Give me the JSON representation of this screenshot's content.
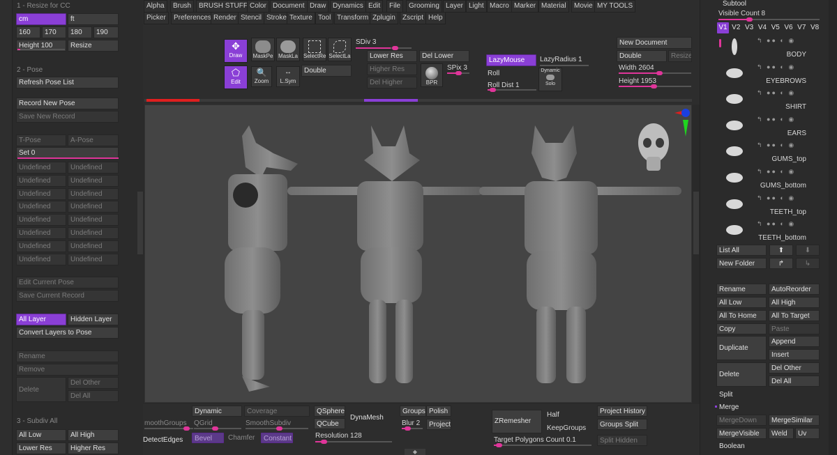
{
  "left_panel": {
    "resize_header": "1 - Resize for CC",
    "unit_cm": "cm",
    "unit_ft": "ft",
    "heights": [
      "160",
      "170",
      "180",
      "190"
    ],
    "height_label": "Height",
    "height_value": "100",
    "resize_button": "Resize",
    "pose_header": "2 - Pose",
    "refresh_pose": "Refresh Pose List",
    "record_new_pose": "Record New Pose",
    "save_new_record": "Save New Record",
    "t_pose": "T-Pose",
    "a_pose": "A-Pose",
    "set_label": "Set",
    "set_value": "0",
    "undefined_label": "Undefined",
    "edit_current_pose": "Edit Current Pose",
    "save_current_record": "Save Current Record",
    "all_layer": "All Layer",
    "hidden_layer": "Hidden Layer",
    "convert_layers": "Convert Layers to Pose",
    "rename": "Rename",
    "remove": "Remove",
    "delete": "Delete",
    "del_other": "Del Other",
    "del_all": "Del All",
    "subdiv_header": "3 - Subdiv All",
    "all_low": "All Low",
    "all_high": "All High",
    "lower_res": "Lower Res",
    "higher_res": "Higher Res"
  },
  "menubar": {
    "row1": [
      "Alpha",
      "Brush",
      "BRUSH STUFF",
      "Color",
      "Document",
      "Draw",
      "Dynamics",
      "Edit",
      "File",
      "Grooming",
      "Layer",
      "Light",
      "Macro",
      "Marker",
      "Material",
      "Movie",
      "MY TOOLS"
    ],
    "row2": [
      "Picker",
      "Preferences",
      "Render",
      "Stencil",
      "Stroke",
      "Texture",
      "Tool",
      "Transform",
      "Zplugin",
      "Zscript",
      "Help"
    ]
  },
  "toolbar": {
    "draw": "Draw",
    "edit": "Edit",
    "mask_pen": "MaskPe",
    "mask_lasso": "MaskLa",
    "zoom": "Zoom",
    "select_rect": "SelectRe",
    "select_lasso": "SelectLa",
    "lsym": "L.Sym",
    "sdiv_label": "SDiv",
    "sdiv_value": "3",
    "lower_res": "Lower Res",
    "del_lower": "Del Lower",
    "higher_res": "Higher Res",
    "del_higher": "Del Higher",
    "double": "Double",
    "bpr": "BPR",
    "spix_label": "SPix",
    "spix_value": "3",
    "lazymouse": "LazyMouse",
    "lazyradius_label": "LazyRadius",
    "lazyradius_value": "1",
    "roll": "Roll",
    "roll_dist_label": "Roll Dist",
    "roll_dist_value": "1",
    "dynamic": "Dynamic",
    "solo": "Solo",
    "new_document": "New Document",
    "doc_double": "Double",
    "doc_resize": "Resize",
    "width_label": "Width",
    "width_value": "2604",
    "height_label": "Height",
    "height_value": "1953"
  },
  "bottom": {
    "dynamic": "Dynamic",
    "coverage": "Coverage",
    "smooth_groups": "moothGroups",
    "qgrid": "QGrid",
    "smooth_subdiv": "SmoothSubdiv",
    "detect_edges": "DetectEdges",
    "bevel": "Bevel",
    "chamfer": "Chamfer",
    "constant": "Constant",
    "qsphere": "QSphere",
    "qcube": "QCube",
    "dynamesh": "DynaMesh",
    "resolution_label": "Resolution",
    "resolution_value": "128",
    "groups": "Groups",
    "polish": "Polish",
    "blur_label": "Blur",
    "blur_value": "2",
    "project": "Project",
    "zremesher": "ZRemesher",
    "half": "Half",
    "keep_groups": "KeepGroups",
    "target_polygons_label": "Target Polygons Count",
    "target_polygons_value": "0.1",
    "project_history": "Project History",
    "groups_split": "Groups Split",
    "split_hidden": "Split Hidden"
  },
  "subtool": {
    "title": "Subtool",
    "visible_count_label": "Visible Count",
    "visible_count_value": "8",
    "versions": [
      "V1",
      "V2",
      "V3",
      "V4",
      "V5",
      "V6",
      "V7",
      "V8"
    ],
    "items": [
      "BODY",
      "EYEBROWS",
      "SHIRT",
      "EARS",
      "GUMS_top",
      "GUMS_bottom",
      "TEETH_top",
      "TEETH_bottom"
    ],
    "list_all": "List All",
    "new_folder": "New Folder",
    "rename": "Rename",
    "auto_reorder": "AutoReorder",
    "all_low": "All Low",
    "all_high": "All High",
    "all_to_home": "All To Home",
    "all_to_target": "All To Target",
    "copy": "Copy",
    "paste": "Paste",
    "duplicate": "Duplicate",
    "append": "Append",
    "insert": "Insert",
    "delete": "Delete",
    "del_other": "Del Other",
    "del_all": "Del All",
    "split": "Split",
    "merge": "Merge",
    "merge_down": "MergeDown",
    "merge_similar": "MergeSimilar",
    "merge_visible": "MergeVisible",
    "weld": "Weld",
    "uv": "Uv",
    "boolean": "Boolean"
  },
  "colors": {
    "accent": "#8a3fd6",
    "slider": "#e0359a",
    "panel": "#2a2a2a",
    "button": "#3e3e3e",
    "viewport": "#444444"
  }
}
